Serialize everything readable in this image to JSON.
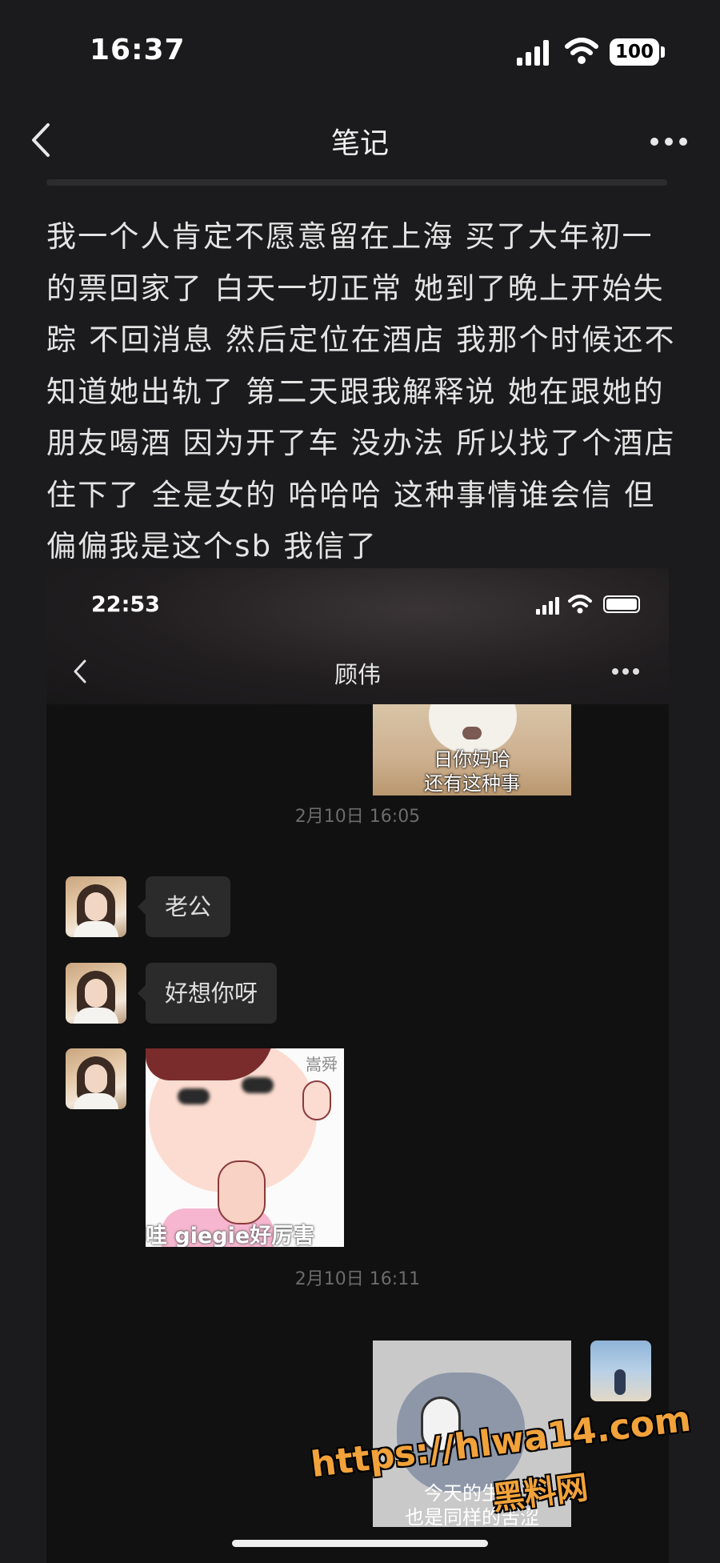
{
  "status_bar": {
    "time": "16:37",
    "battery": "100",
    "signal_icon": "cellular-signal-icon",
    "wifi_icon": "wifi-icon"
  },
  "nav": {
    "title": "笔记",
    "back_icon": "chevron-left-icon",
    "more_icon": "more-dots-icon"
  },
  "note": {
    "text": "我一个人肯定不愿意留在上海 买了大年初一的票回家了  白天一切正常  她到了晚上开始失踪 不回消息 然后定位在酒店 我那个时候还不知道她出轨了  第二天跟我解释说 她在跟她的朋友喝酒 因为开了车 没办法 所以找了个酒店 住下了  全是女的 哈哈哈 这种事情谁会信 但偏偏我是这个sb 我信了"
  },
  "embedded_chat": {
    "status_time": "22:53",
    "contact_name": "顾伟",
    "messages": {
      "sticker_cat_caption": "日你妈哈\n还有这种事",
      "timestamp_1": "2月10日 16:05",
      "bubble_1": "老公",
      "bubble_2": "好想你呀",
      "sticker_boy_caption": "哇 giegie好厉害",
      "sticker_boy_corner": "嵩舜",
      "timestamp_2": "2月10日 16:11",
      "sticker_tom_caption": "今天的生活\n也是同样的苦涩"
    }
  },
  "watermark": {
    "url": "https://hlwa14.com",
    "name": "黑料网"
  },
  "colors": {
    "background": "#1b1b1d",
    "embed_background": "#111111",
    "bubble": "#2b2b2b",
    "watermark": "#f2a23a"
  }
}
